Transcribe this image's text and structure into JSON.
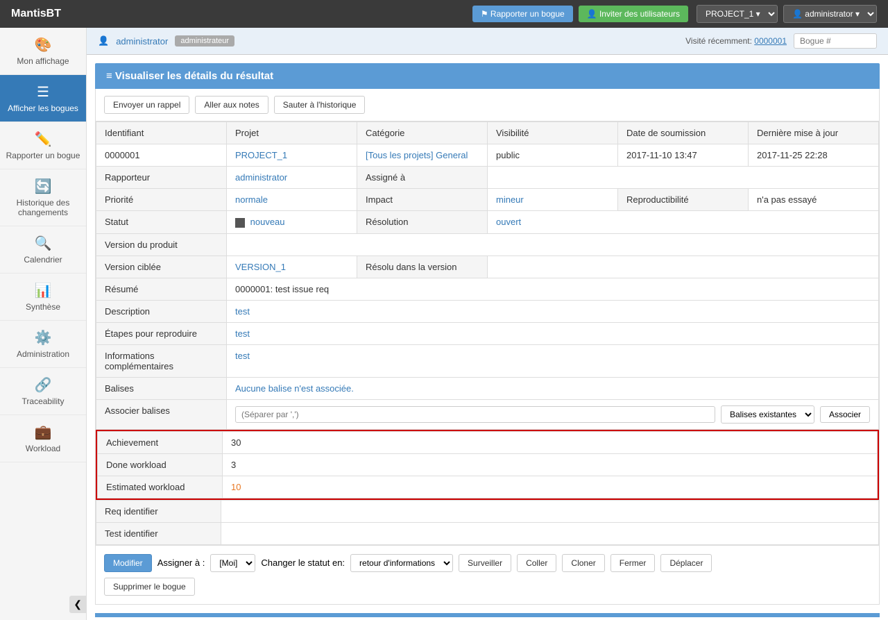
{
  "brand": "MantisBT",
  "topnav": {
    "report_bug": "⚑ Rapporter un bogue",
    "invite_users": "👤 Inviter des utilisateurs",
    "project": "PROJECT_1 ▾",
    "user": "👤 administrator ▾"
  },
  "sidebar": {
    "items": [
      {
        "id": "mon-affichage",
        "icon": "🎨",
        "label": "Mon affichage"
      },
      {
        "id": "afficher-bogues",
        "icon": "☰",
        "label": "Afficher les bogues",
        "active": true
      },
      {
        "id": "rapporter-bogue",
        "icon": "✏️",
        "label": "Rapporter un bogue"
      },
      {
        "id": "historique",
        "icon": "🔄",
        "label": "Historique des changements"
      },
      {
        "id": "calendrier",
        "icon": "🔍",
        "label": "Calendrier"
      },
      {
        "id": "synthese",
        "icon": "📊",
        "label": "Synthèse"
      },
      {
        "id": "administration",
        "icon": "⚙️",
        "label": "Administration"
      },
      {
        "id": "traceability",
        "icon": "🔗",
        "label": "Traceability"
      },
      {
        "id": "workload",
        "icon": "💼",
        "label": "Workload"
      }
    ],
    "collapse_icon": "❮"
  },
  "sub_header": {
    "user_link": "administrator",
    "badge": "administrateur",
    "visited_label": "Visité récemment:",
    "visited_link": "0000001",
    "search_placeholder": "Bogue #"
  },
  "section_title": "≡ Visualiser les détails du résultat",
  "action_buttons": [
    {
      "id": "envoyer-rappel",
      "label": "Envoyer un rappel"
    },
    {
      "id": "aller-notes",
      "label": "Aller aux notes"
    },
    {
      "id": "sauter-historique",
      "label": "Sauter à l'historique"
    }
  ],
  "table": {
    "headers": {
      "identifiant": "Identifiant",
      "projet": "Projet",
      "categorie": "Catégorie",
      "visibilite": "Visibilité",
      "date_soumission": "Date de soumission",
      "derniere_maj": "Dernière mise à jour"
    },
    "row1": {
      "identifiant": "0000001",
      "projet": "PROJECT_1",
      "categorie": "[Tous les projets] General",
      "visibilite": "public",
      "date_soumission": "2017-11-10 13:47",
      "derniere_maj": "2017-11-25 22:28"
    },
    "rapporteur_label": "Rapporteur",
    "rapporteur_value": "administrator",
    "assigne_label": "Assigné à",
    "priorite_label": "Priorité",
    "priorite_value": "normale",
    "impact_label": "Impact",
    "impact_value": "mineur",
    "reproductibilite_label": "Reproductibilité",
    "reproductibilite_value": "n'a pas essayé",
    "statut_label": "Statut",
    "statut_value": "nouveau",
    "resolution_label": "Résolution",
    "resolution_value": "ouvert",
    "version_produit_label": "Version du produit",
    "version_ciblee_label": "Version ciblée",
    "version_ciblee_value": "VERSION_1",
    "resolu_label": "Résolu dans la version",
    "resume_label": "Résumé",
    "resume_value": "0000001: test issue req",
    "description_label": "Description",
    "description_value": "test",
    "etapes_label": "Étapes pour reproduire",
    "etapes_value": "test",
    "infos_label": "Informations complémentaires",
    "infos_value": "test",
    "balises_label": "Balises",
    "balises_value": "Aucune balise n'est associée.",
    "associer_balises_label": "Associer balises",
    "balises_placeholder": "(Séparer par ',')",
    "balises_select": "Balises existantes",
    "balises_btn": "Associer"
  },
  "custom_fields": {
    "achievement_label": "Achievement",
    "achievement_value": "30",
    "done_workload_label": "Done workload",
    "done_workload_value": "3",
    "estimated_workload_label": "Estimated workload",
    "estimated_workload_value": "10"
  },
  "extra_rows": {
    "req_label": "Req identifier",
    "test_label": "Test identifier"
  },
  "bottom_actions": {
    "modifier": "Modifier",
    "assigner_label": "Assigner à :",
    "assigner_option": "[Moi]",
    "changer_statut_label": "Changer le statut en:",
    "changer_statut_option": "retour d'informations",
    "surveiller": "Surveiller",
    "coller": "Coller",
    "cloner": "Cloner",
    "fermer": "Fermer",
    "deplacer": "Déplacer",
    "supprimer": "Supprimer le bogue"
  }
}
